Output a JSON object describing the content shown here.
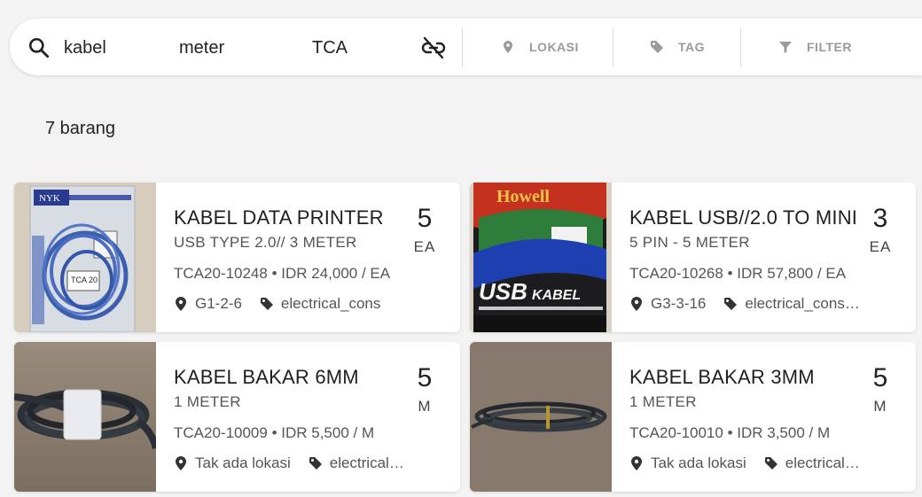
{
  "search": {
    "terms": [
      "kabel",
      "meter",
      "TCA"
    ],
    "filters": [
      {
        "label": "LOKASI",
        "icon": "location-pin-icon"
      },
      {
        "label": "TAG",
        "icon": "tag-icon"
      },
      {
        "label": "FILTER",
        "icon": "funnel-icon"
      }
    ]
  },
  "results": {
    "count_label": "7 barang",
    "items": [
      {
        "title": "KABEL DATA PRINTER",
        "subtitle": "USB TYPE 2.0// 3 METER",
        "meta": "TCA20-10248 • IDR 24,000 / EA",
        "location": "G1-2-6",
        "category": "electrical_cons",
        "quantity": "5",
        "unit": "EA",
        "image": "blue coiled usb printer cable in NYK package"
      },
      {
        "title": "KABEL USB//2.0 TO MINI",
        "subtitle": "5 PIN - 5 METER",
        "meta": "TCA20-10268 • IDR 57,800 / EA",
        "location": "G3-3-16",
        "category": "electrical_consumables",
        "quantity": "3",
        "unit": "EA",
        "image": "USB kabel package in green and black packaging"
      },
      {
        "title": "KABEL BAKAR 6MM",
        "subtitle": "1 METER",
        "meta": "TCA20-10009 • IDR 5,500 / M",
        "location": "Tak ada lokasi",
        "category": "electrical_consumables",
        "quantity": "5",
        "unit": "M",
        "image": "black heat shrink tube coil on wooden table"
      },
      {
        "title": "KABEL BAKAR 3MM",
        "subtitle": "1 METER",
        "meta": "TCA20-10010 • IDR 3,500 / M",
        "location": "Tak ada lokasi",
        "category": "electrical_consumables",
        "quantity": "5",
        "unit": "M",
        "image": "thin black heat shrink tube coil on wooden table"
      }
    ]
  },
  "colors": {
    "background": "#f3f3f3",
    "card": "#ffffff",
    "muted_filter_text": "#9a9a9a"
  }
}
